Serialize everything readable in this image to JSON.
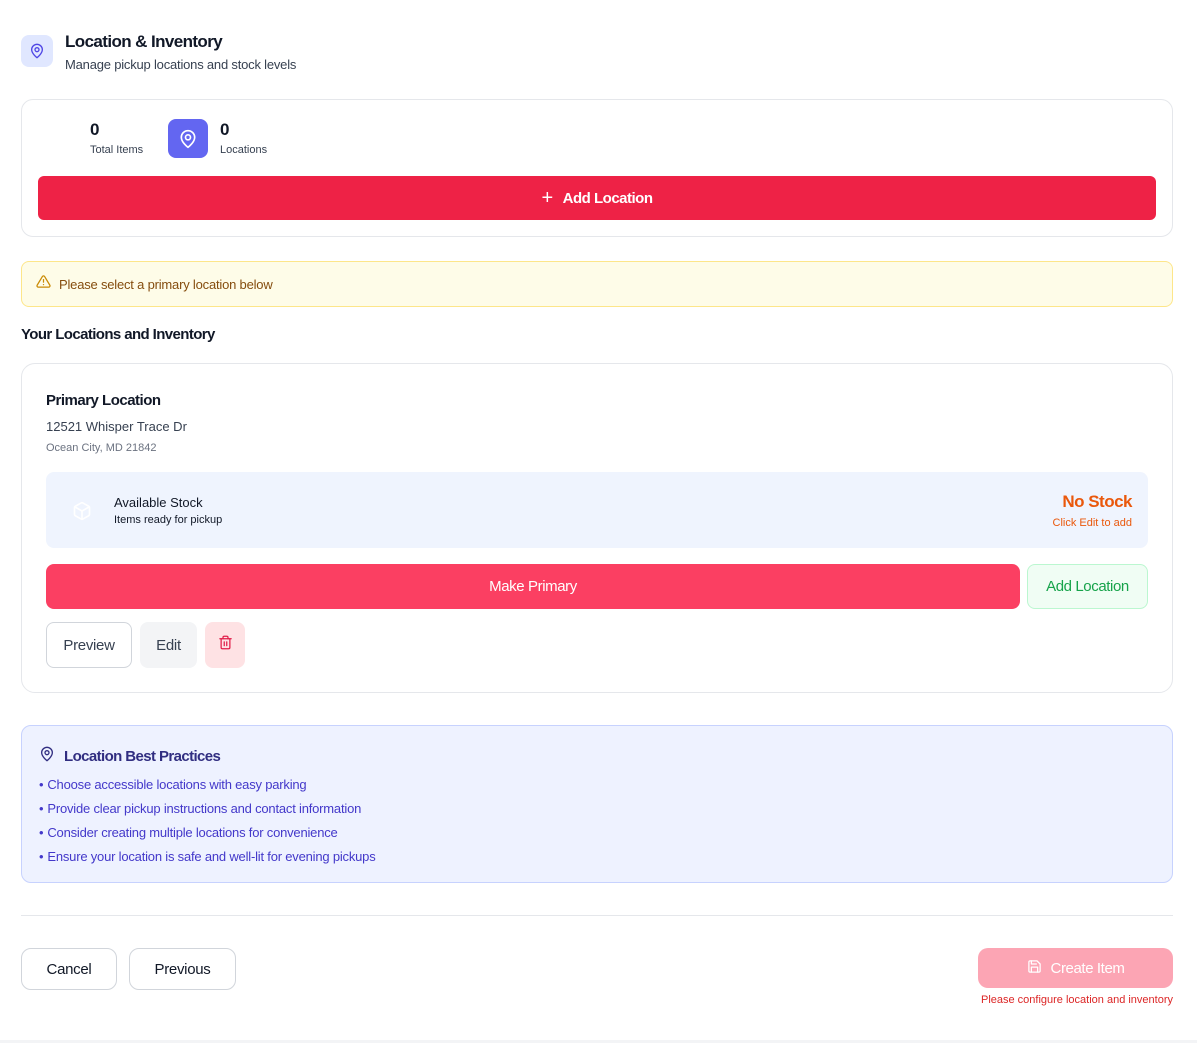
{
  "header": {
    "title": "Location & Inventory",
    "subtitle": "Manage pickup locations and stock levels",
    "icon": "map-pin-icon"
  },
  "stats": {
    "total_items_value": "0",
    "total_items_label": "Total Items",
    "locations_value": "0",
    "locations_label": "Locations",
    "add_location_label": "Add Location"
  },
  "alert": {
    "text": "Please select a primary location below",
    "icon": "warning-triangle-icon"
  },
  "section": {
    "title": "Your Locations and Inventory"
  },
  "location": {
    "name": "Primary Location",
    "address": "12521 Whisper Trace Dr",
    "city": "Ocean City, MD 21842",
    "stock_title": "Available Stock",
    "stock_subtitle": "Items ready for pickup",
    "stock_status": "No Stock",
    "stock_hint": "Click Edit to add",
    "make_primary_label": "Make Primary",
    "add_location_label": "Add Location",
    "preview_label": "Preview",
    "edit_label": "Edit"
  },
  "tips": {
    "title": "Location Best Practices",
    "items": [
      "Choose accessible locations with easy parking",
      "Provide clear pickup instructions and contact information",
      "Consider creating multiple locations for convenience",
      "Ensure your location is safe and well-lit for evening pickups"
    ]
  },
  "footer": {
    "cancel_label": "Cancel",
    "previous_label": "Previous",
    "create_label": "Create Item",
    "create_error": "Please configure location and inventory"
  },
  "colors": {
    "primary_red": "#ee2246",
    "indigo": "#6366f1",
    "warning_bg": "#fefce8",
    "info_bg": "#eef2ff",
    "success_green": "#16a34a",
    "stock_orange": "#ea580c"
  }
}
